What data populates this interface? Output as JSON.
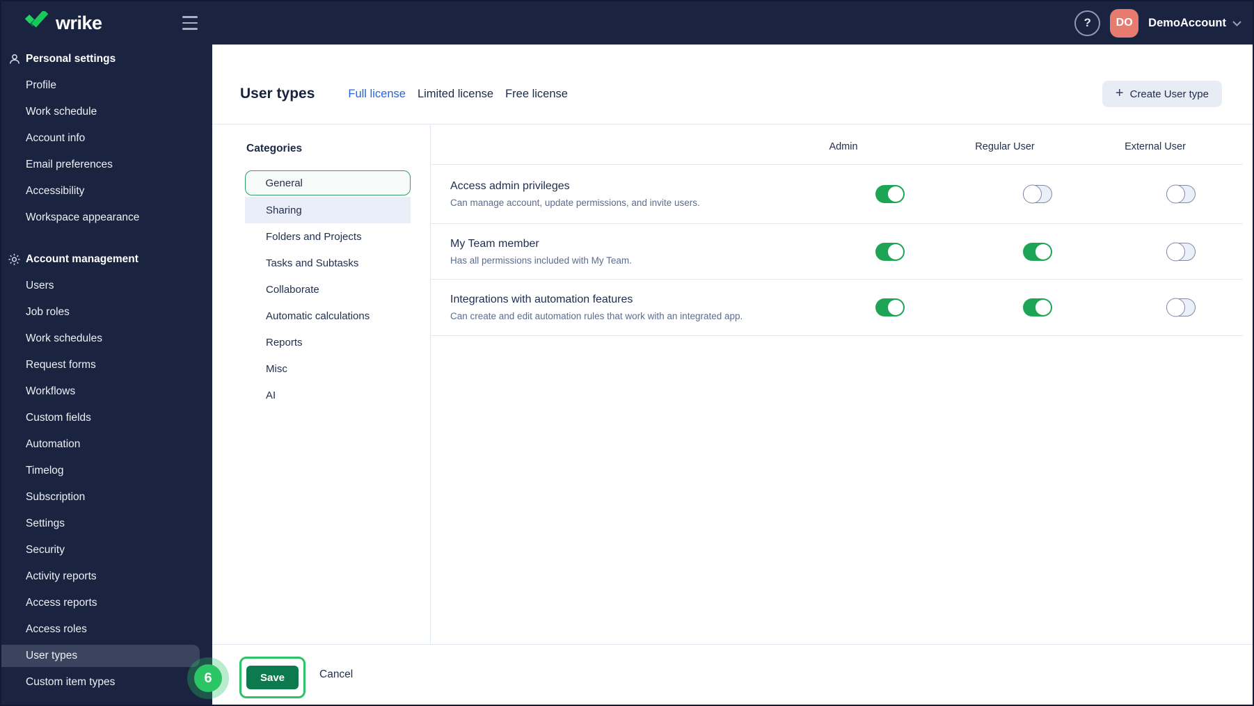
{
  "topbar": {
    "logo_text": "wrike",
    "help_label": "?",
    "avatar_initials": "DO",
    "account_name": "DemoAccount"
  },
  "sidebar": {
    "selected_item": "User types",
    "sections": [
      {
        "label": "Personal settings",
        "icon": "person-icon",
        "items": [
          "Profile",
          "Work schedule",
          "Account info",
          "Email preferences",
          "Accessibility",
          "Workspace appearance"
        ]
      },
      {
        "label": "Account management",
        "icon": "gear-icon",
        "items": [
          "Users",
          "Job roles",
          "Work schedules",
          "Request forms",
          "Workflows",
          "Custom fields",
          "Automation",
          "Timelog",
          "Subscription",
          "Settings",
          "Security",
          "Activity reports",
          "Access reports",
          "Access roles",
          "User types",
          "Custom item types"
        ]
      }
    ]
  },
  "header": {
    "title": "User types",
    "tabs": [
      {
        "label": "Full license",
        "active": true
      },
      {
        "label": "Limited license",
        "active": false
      },
      {
        "label": "Free license",
        "active": false
      }
    ],
    "create_button_label": "Create User type",
    "plus_icon": "+"
  },
  "categories": {
    "title": "Categories",
    "items": [
      {
        "label": "General",
        "state": "selected"
      },
      {
        "label": "Sharing",
        "state": "highlighted"
      },
      {
        "label": "Folders and Projects",
        "state": "normal"
      },
      {
        "label": "Tasks and Subtasks",
        "state": "normal"
      },
      {
        "label": "Collaborate",
        "state": "normal"
      },
      {
        "label": "Automatic calculations",
        "state": "normal"
      },
      {
        "label": "Reports",
        "state": "normal"
      },
      {
        "label": "Misc",
        "state": "normal"
      },
      {
        "label": "AI",
        "state": "normal"
      }
    ]
  },
  "table": {
    "columns": [
      "Admin",
      "Regular User",
      "External User"
    ],
    "rows": [
      {
        "title": "Access admin privileges",
        "description": "Can manage account, update permissions, and invite users.",
        "toggles": [
          true,
          false,
          false
        ]
      },
      {
        "title": "My Team member",
        "description": "Has all permissions included with My Team.",
        "toggles": [
          true,
          true,
          false
        ]
      },
      {
        "title": "Integrations with automation features",
        "description": "Can create and edit automation rules that work with an integrated app.",
        "toggles": [
          true,
          true,
          false
        ]
      }
    ]
  },
  "footer": {
    "step_badge": "6",
    "save_label": "Save",
    "cancel_label": "Cancel"
  },
  "colors": {
    "topbar_bg": "#1a233f",
    "accent_blue": "#2464e4",
    "toggle_on_green": "#1ea455",
    "save_green": "#0d7a4e",
    "annotation_green": "#2bc565",
    "brand_green": "#1fd463",
    "avatar_salmon": "#e87b70",
    "sidebar_selected_bg": "#3a445f",
    "category_selected_border": "#2f9e68",
    "divider": "#e4e9f1"
  }
}
